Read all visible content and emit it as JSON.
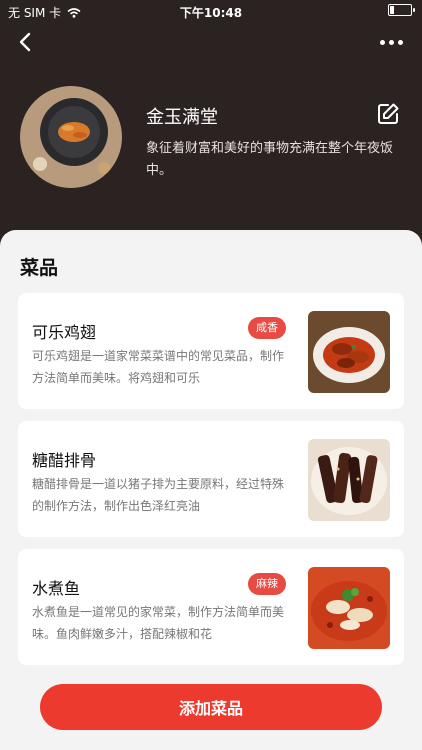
{
  "status_bar": {
    "carrier": "无 SIM 卡",
    "time": "下午10:48",
    "battery_level": 0.12
  },
  "nav": {
    "back_icon": "back-chevron-icon",
    "more_icon": "more-dots-icon"
  },
  "header": {
    "title": "金玉满堂",
    "description": "象征着财富和美好的事物充满在整个年夜饭中。",
    "edit_icon": "edit-icon"
  },
  "section": {
    "title": "菜品"
  },
  "dishes": [
    {
      "name": "可乐鸡翅",
      "tag": "咸香",
      "description": "可乐鸡翅是一道家常菜菜谱中的常见菜品，制作方法简单而美味。将鸡翅和可乐"
    },
    {
      "name": "糖醋排骨",
      "tag": "",
      "description": "糖醋排骨是一道以猪子排为主要原料，经过特殊的制作方法，制作出色泽红亮油"
    },
    {
      "name": "水煮鱼",
      "tag": "麻辣",
      "description": "水煮鱼是一道常见的家常菜，制作方法简单而美味。鱼肉鲜嫩多汁，搭配辣椒和花"
    }
  ],
  "footer": {
    "add_button": "添加菜品"
  },
  "colors": {
    "header_bg": "#2b2322",
    "accent": "#ed3a2e",
    "tag": "#e84b43"
  }
}
